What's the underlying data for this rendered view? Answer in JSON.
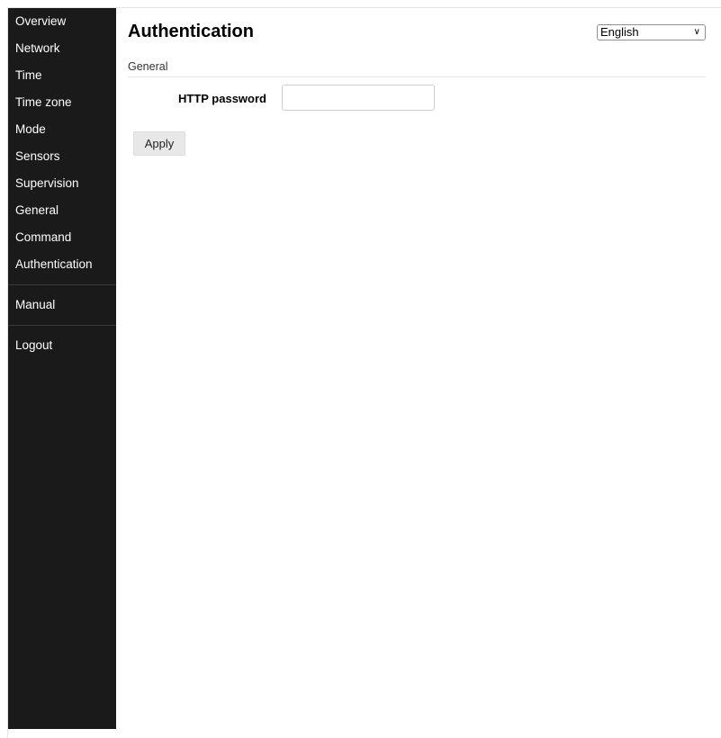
{
  "sidebar": {
    "items": [
      {
        "label": "Overview"
      },
      {
        "label": "Network"
      },
      {
        "label": "Time"
      },
      {
        "label": "Time zone"
      },
      {
        "label": "Mode"
      },
      {
        "label": "Sensors"
      },
      {
        "label": "Supervision"
      },
      {
        "label": "General"
      },
      {
        "label": "Command"
      },
      {
        "label": "Authentication"
      }
    ],
    "manual_label": "Manual",
    "logout_label": "Logout"
  },
  "page": {
    "title": "Authentication",
    "language": {
      "selected": "English"
    }
  },
  "section": {
    "label": "General"
  },
  "form": {
    "password_label": "HTTP password",
    "password_value": "",
    "password_placeholder": ""
  },
  "actions": {
    "apply_label": "Apply"
  },
  "colors": {
    "sidebar_bg": "#1a1a1a",
    "sidebar_text": "#ffffff",
    "button_bg": "#e8e8e8"
  }
}
